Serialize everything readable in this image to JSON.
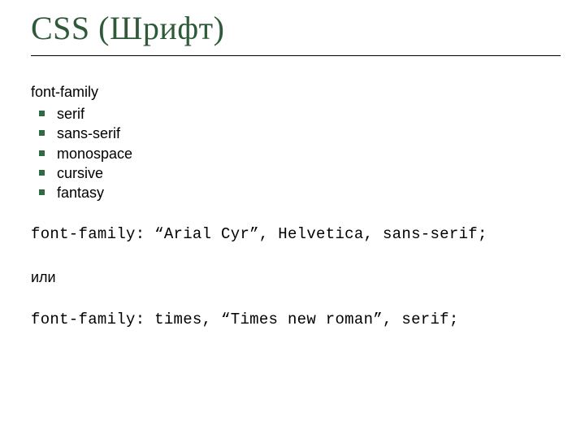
{
  "title": "CSS (Шрифт)",
  "heading": "font-family",
  "items": [
    "serif",
    "sans-serif",
    "monospace",
    "cursive",
    "fantasy"
  ],
  "code1": "font-family: “Arial Cyr”, Helvetica, sans-serif;",
  "or": "или",
  "code2": "font-family: times, “Times new roman”, serif;"
}
